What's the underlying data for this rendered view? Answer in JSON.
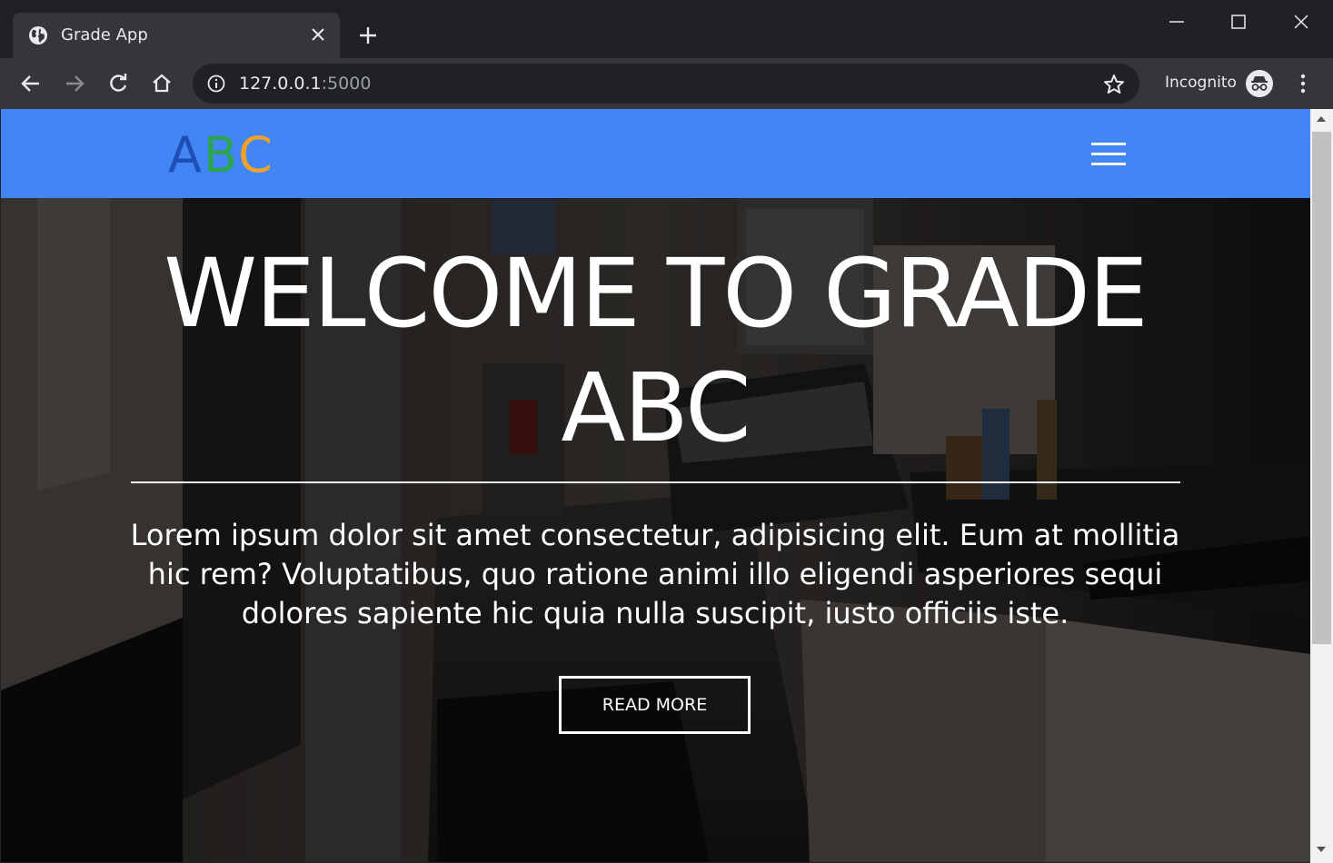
{
  "browser": {
    "tab": {
      "title": "Grade App"
    },
    "address": {
      "host": "127.0.0.1",
      "port": ":5000"
    },
    "incognito_label": "Incognito",
    "colors": {
      "frame": "#202124",
      "toolbar": "#35363a",
      "text": "#e8eaed"
    }
  },
  "site": {
    "logo": {
      "a": "A",
      "b": "B",
      "c": "C",
      "colors": [
        "#1f4fb6",
        "#2da44e",
        "#f0a12a"
      ]
    },
    "navbar_color": "#4285f4",
    "hero": {
      "title": "WELCOME TO GRADE ABC",
      "text": "Lorem ipsum dolor sit amet consectetur, adipisicing elit. Eum at mollitia hic rem? Voluptatibus, quo ratione animi illo eligendi asperiores sequi dolores sapiente hic quia nulla suscipit, iusto officiis iste.",
      "button_label": "READ MORE"
    }
  },
  "icons": {
    "tab": "globe-icon",
    "toolbar": [
      "back-arrow-icon",
      "forward-arrow-icon",
      "reload-icon",
      "home-icon",
      "info-icon",
      "star-icon",
      "incognito-icon",
      "menu-icon"
    ],
    "site": [
      "hamburger-icon"
    ]
  }
}
